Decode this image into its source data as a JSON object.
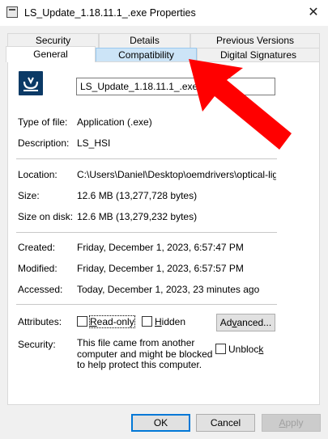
{
  "window": {
    "title": "LS_Update_1.18.11.1_.exe Properties",
    "close_glyph": "✕"
  },
  "tabs_row1": [
    {
      "label": "Security"
    },
    {
      "label": "Details"
    },
    {
      "label": "Previous Versions"
    }
  ],
  "tabs_row2": [
    {
      "label": "General"
    },
    {
      "label": "Compatibility"
    },
    {
      "label": "Digital Signatures"
    }
  ],
  "general": {
    "file_name": "LS_Update_1.18.11.1_.exe",
    "type_label": "Type of file:",
    "type_value": "Application (.exe)",
    "description_label": "Description:",
    "description_value": "LS_HSI",
    "location_label": "Location:",
    "location_value": "C:\\Users\\Daniel\\Desktop\\oemdrivers\\optical-lightsc",
    "size_label": "Size:",
    "size_value": "12.6 MB (13,277,728 bytes)",
    "size_on_disk_label": "Size on disk:",
    "size_on_disk_value": "12.6 MB (13,279,232 bytes)",
    "created_label": "Created:",
    "created_value": "Friday, December 1, 2023, 6:57:47 PM",
    "modified_label": "Modified:",
    "modified_value": "Friday, December 1, 2023, 6:57:57 PM",
    "accessed_label": "Accessed:",
    "accessed_value": "Today, December 1, 2023, 23 minutes ago",
    "attributes_label": "Attributes:",
    "readonly": {
      "pre": "",
      "accel": "R",
      "post": "ead-only",
      "checked": false
    },
    "hidden": {
      "pre": "",
      "accel": "H",
      "post": "idden",
      "checked": false
    },
    "advanced": {
      "pre": "Ad",
      "accel": "v",
      "post": "anced..."
    },
    "security_label": "Security:",
    "security_text": "This file came from another computer and might be blocked to help protect this computer.",
    "unblock": {
      "pre": "Unbloc",
      "accel": "k",
      "post": "",
      "checked": false
    }
  },
  "buttons": {
    "ok": "OK",
    "cancel": "Cancel",
    "apply": "Apply",
    "apply_accel": "A",
    "apply_post": "pply"
  },
  "annotation": {
    "arrow_color": "#ff0000",
    "points_to": "Compatibility"
  },
  "colors": {
    "accent": "#0078d7",
    "tab_highlight": "#cce4f7",
    "icon_bg": "#0b3a66"
  }
}
